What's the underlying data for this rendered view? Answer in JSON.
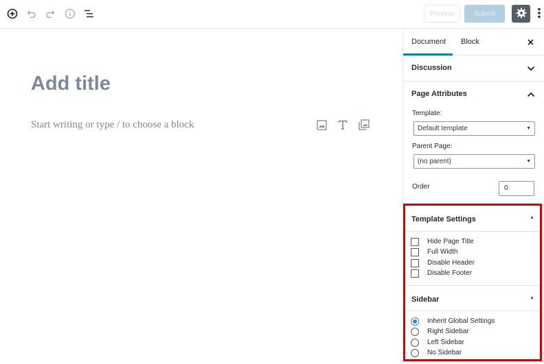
{
  "toolbar": {
    "icons": [
      "add-block-icon",
      "undo-icon",
      "redo-icon",
      "info-icon",
      "list-view-icon"
    ],
    "preview_label": "Preview",
    "submit_label": "Submit",
    "settings_icon": "gear-icon",
    "more_icon": "vertical-ellipsis-icon"
  },
  "editor": {
    "title_placeholder": "Add title",
    "block_placeholder": "Start writing or type / to choose a block",
    "inserter_icons": [
      "image-icon",
      "heading-icon",
      "gallery-icon"
    ]
  },
  "sidebar": {
    "tabs": {
      "document": "Document",
      "block": "Block"
    },
    "close_icon": "close-icon",
    "discussion": {
      "title": "Discussion"
    },
    "page_attributes": {
      "title": "Page Attributes",
      "template_label": "Template:",
      "template_value": "Default template",
      "parent_label": "Parent Page:",
      "parent_value": "(no parent)",
      "order_label": "Order",
      "order_value": "0"
    },
    "template_settings": {
      "title": "Template Settings",
      "options": [
        "Hide Page Title",
        "Full Width",
        "Disable Header",
        "Disable Footer"
      ]
    },
    "sidebar_panel": {
      "title": "Sidebar",
      "options": [
        "Inherit Global Settings",
        "Right Sidebar",
        "Left Sidebar",
        "No Sidebar"
      ],
      "selected": "Inherit Global Settings"
    }
  },
  "colors": {
    "accent": "#0085ba",
    "highlight_border": "#d40000",
    "radio_selected": "#3582c4",
    "submit_bg": "#b3cfe2",
    "settings_bg": "#555d66"
  }
}
